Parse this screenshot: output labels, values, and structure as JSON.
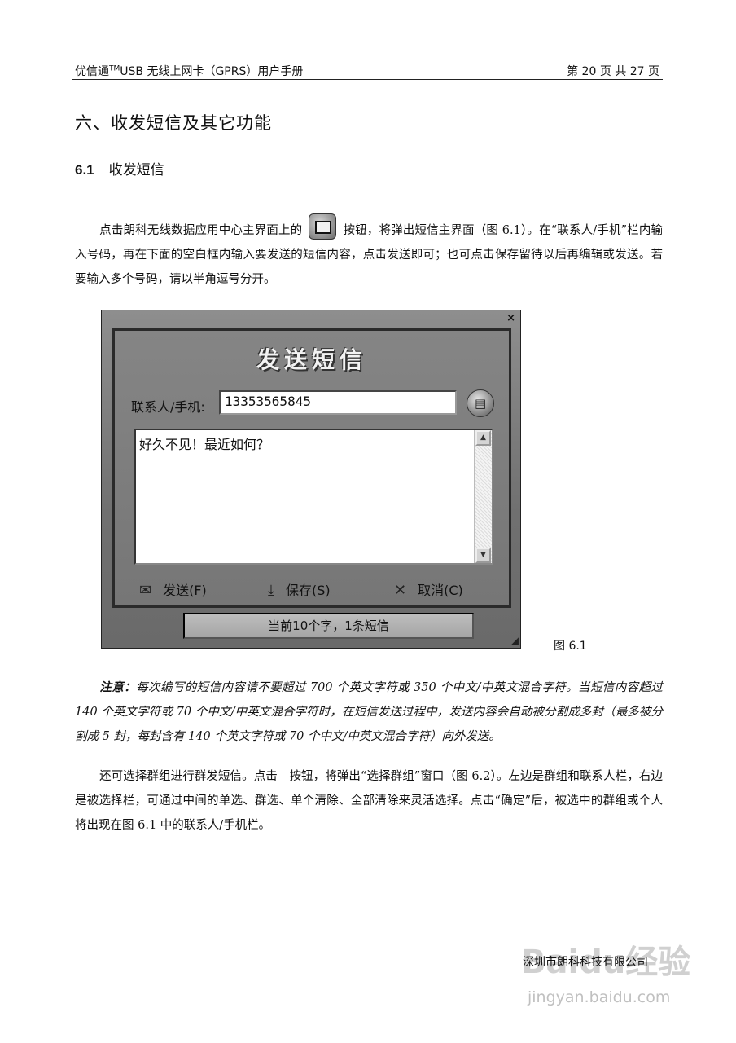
{
  "header": {
    "title_pre": "优信通",
    "tm": "TM",
    "title_post": "USB 无线上网卡（GPRS）用户手册",
    "page_info": "第 20 页 共 27 页"
  },
  "chapter_title": "六、收发短信及其它功能",
  "section": {
    "number": "6.1",
    "title": "收发短信"
  },
  "para1": {
    "before_icon": "点击朗科无线数据应用中心主界面上的",
    "after_icon": "按钮，将弹出短信主界面（图 6.1）。在“联系人/手机”栏内输入号码，再在下面的空白框内输入要发送的短信内容，点击发送即可；也可点击保存留待以后再编辑或发送。若要输入多个号码，请以半角逗号分开。"
  },
  "dialog": {
    "close_glyph": "×",
    "title": "发送短信",
    "contact_label": "联系人/手机:",
    "contact_value": "13353565845",
    "message_text": "好久不见！最近如何？",
    "send_label": "发送(F)",
    "save_label": "保存(S)",
    "cancel_label": "取消(C)",
    "status_text": "当前10个字，1条短信"
  },
  "figure_caption": "图 6.1",
  "note": {
    "label": "注意：",
    "text": "每次编写的短信内容请不要超过 700 个英文字符或 350 个中文/中英文混合字符。当短信内容超过 140 个英文字符或 70 个中文/中英文混合字符时，在短信发送过程中，发送内容会自动被分割成多封（最多被分割成 5 封，每封含有 140 个英文字符或 70 个中文/中英文混合字符）向外发送。"
  },
  "para2": "还可选择群组进行群发短信。点击　按钮，将弹出“选择群组”窗口（图 6.2）。左边是群组和联系人栏，右边是被选择栏，可通过中间的单选、群选、单个清除、全部清除来灵活选择。点击“确定”后，被选中的群组或个人将出现在图 6.1 中的联系人/手机栏。",
  "footer_company": "深圳市朗科科技有限公司",
  "watermark": {
    "brand": "Baidu经验",
    "url": "jingyan.baidu.com"
  }
}
